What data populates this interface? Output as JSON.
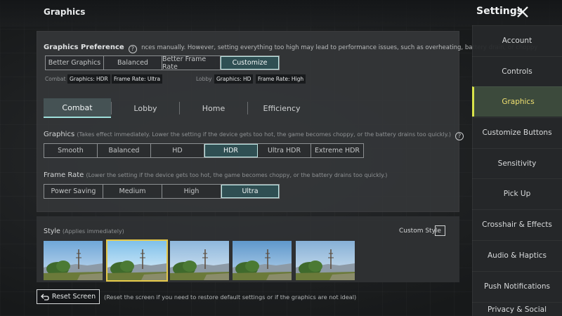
{
  "header": {
    "page_title": "Graphics",
    "settings_title": "Settings"
  },
  "preference": {
    "label": "Graphics Preference",
    "help_glyph": "?",
    "desc": "nces manually. However, setting everything too high may lead to performance issues, such as overheating, battery drain, or choppy",
    "options": [
      "Better Graphics",
      "Balanced",
      "Better Frame Rate",
      "Customize"
    ],
    "selected": "Customize"
  },
  "summary": {
    "combat_label": "Combat",
    "combat_graphics": "Graphics: HDR",
    "combat_frame": "Frame Rate: Ultra",
    "lobby_label": "Lobby",
    "lobby_graphics": "Graphics: HD",
    "lobby_frame": "Frame Rate: High"
  },
  "tabs": [
    "Combat",
    "Lobby",
    "Home",
    "Efficiency"
  ],
  "selected_tab": "Combat",
  "graphics": {
    "label": "Graphics",
    "note": "(Takes effect immediately. Lower the setting if the device gets too hot, the game becomes choppy, or the battery drains too quickly.)",
    "help_glyph": "?",
    "options": [
      "Smooth",
      "Balanced",
      "HD",
      "HDR",
      "Ultra HDR",
      "Extreme HDR"
    ],
    "selected": "HDR"
  },
  "frame_rate": {
    "label": "Frame Rate",
    "note": "(Lower the setting if the device gets too hot, the game becomes choppy, or the battery drains too quickly.)",
    "options": [
      "Power Saving",
      "Medium",
      "High",
      "Ultra"
    ],
    "selected": "Ultra"
  },
  "style": {
    "label": "Style",
    "note": "(Applies immediately)",
    "custom_label": "Custom Style",
    "selected_index": 1,
    "count": 5
  },
  "reset": {
    "label": "Reset Screen",
    "note": "(Reset the screen if you need to restore default settings or if the graphics are not ideal)"
  },
  "sidebar": {
    "items": [
      "Account",
      "Controls",
      "Graphics",
      "Customize Buttons",
      "Sensitivity",
      "Pick Up",
      "Crosshair & Effects",
      "Audio & Haptics",
      "Push Notifications",
      "Privacy & Social"
    ],
    "selected": "Graphics"
  },
  "colors": {
    "accent": "#9fe0dc",
    "selected_fill": "#2f4f53",
    "sidebar_selected_text": "#f0e070",
    "thumb_selected": "#e6c94a"
  }
}
